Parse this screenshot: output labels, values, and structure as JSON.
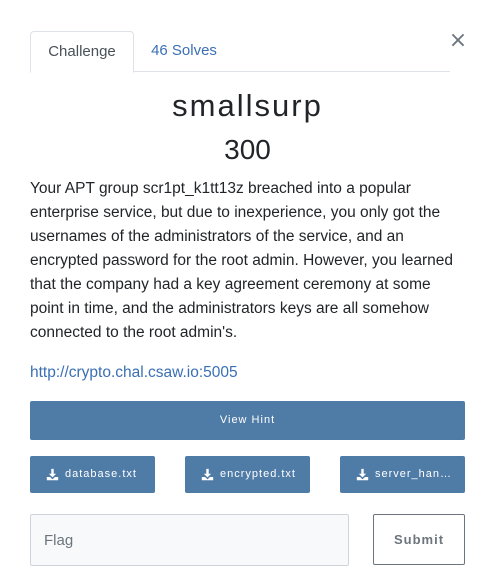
{
  "modal": {
    "close_glyph": "×"
  },
  "tabs": [
    {
      "label": "Challenge",
      "active": true
    },
    {
      "label": "46 Solves",
      "active": false
    }
  ],
  "challenge": {
    "name": "smallsurp",
    "value": "300",
    "description": "Your APT group scr1pt_k1tt13z breached into a popular enterprise service, but due to inexperience, you only got the usernames of the administrators of the service, and an encrypted password for the root admin. However, you learned that the company had a key agreement ceremony at some point in time, and the administrators keys are all somehow connected to the root admin's.",
    "link": "http://crypto.chal.csaw.io:5005"
  },
  "hint_button": {
    "label": "View Hint"
  },
  "files": [
    {
      "name": "database.txt",
      "icon": "download-icon"
    },
    {
      "name": "encrypted.txt",
      "icon": "download-icon"
    },
    {
      "name": "server_handout.py",
      "icon": "download-icon"
    }
  ],
  "flag_form": {
    "placeholder": "Flag",
    "value": "",
    "submit_label": "Submit"
  },
  "colors": {
    "primary_button": "#4f7ba7",
    "link": "#3a6fb4",
    "text": "#212529"
  }
}
